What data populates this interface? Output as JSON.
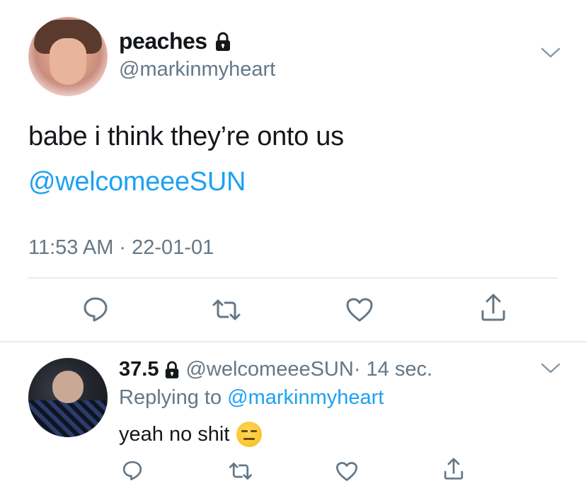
{
  "main_tweet": {
    "display_name": "peaches",
    "handle": "@markinmyheart",
    "text": "babe i think they’re onto us",
    "mention": "@welcomeeeSUN",
    "timestamp": "11:53 AM · 22-01-01"
  },
  "reply": {
    "display_name": "37.5",
    "handle": "@welcomeeeSUN",
    "time": " · 14 sec.",
    "replying_prefix": "Replying to ",
    "replying_to": "@markinmyheart",
    "text": "yeah no shit"
  },
  "icons": {
    "lock": "lock-icon",
    "chevron": "chevron-down-icon",
    "reply": "reply-icon",
    "retweet": "retweet-icon",
    "like": "heart-icon",
    "share": "share-icon",
    "emoji": "expressionless-face-emoji"
  },
  "colors": {
    "link": "#1da1f2",
    "secondary_text": "#657786",
    "primary_text": "#14171a",
    "divider": "#e6ecf0",
    "icon": "#657786"
  }
}
